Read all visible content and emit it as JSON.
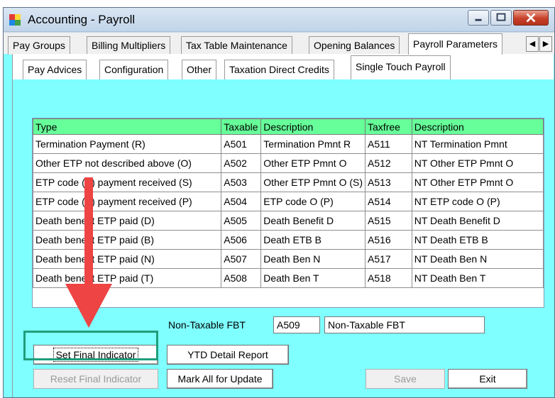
{
  "window": {
    "title": "Accounting - Payroll"
  },
  "outer_tabs": [
    {
      "label": "Pay Groups"
    },
    {
      "label": "Billing Multipliers"
    },
    {
      "label": "Tax Table Maintenance"
    },
    {
      "label": "Opening Balances"
    },
    {
      "label": "Payroll Parameters",
      "active": true
    }
  ],
  "inner_tabs": [
    {
      "label": "Pay Advices"
    },
    {
      "label": "Configuration"
    },
    {
      "label": "Other"
    },
    {
      "label": "Taxation Direct Credits"
    },
    {
      "label": "Single Touch Payroll",
      "active": true
    }
  ],
  "grid": {
    "columns": [
      "Type",
      "Taxable",
      "Description",
      "Taxfree",
      "Description"
    ],
    "rows": [
      [
        "Termination Payment  (R)",
        "A501",
        "Termination Pmnt R",
        "A511",
        "NT Termination Pmnt"
      ],
      [
        "Other ETP not described above (O)",
        "A502",
        "Other ETP Pmnt O",
        "A512",
        "NT Other ETP Pmnt O"
      ],
      [
        "ETP code (S) payment received (S)",
        "A503",
        "Other ETP Pmnt O (S)",
        "A513",
        "NT Other ETP Pmnt O"
      ],
      [
        "ETP code (P) payment received  (P)",
        "A504",
        "ETP code O (P)",
        "A514",
        "NT ETP code O (P)"
      ],
      [
        "Death benefit ETP paid  (D)",
        "A505",
        "Death Benefit D",
        "A515",
        "NT Death Benefit D"
      ],
      [
        "Death benefit ETP paid  (B)",
        "A506",
        "Death ETB B",
        "A516",
        "NT Death ETB B"
      ],
      [
        "Death benefit ETP paid  (N)",
        "A507",
        "Death Ben N",
        "A517",
        "NT Death Ben N"
      ],
      [
        "Death benefit ETP paid  (T)",
        "A508",
        "Death Ben T",
        "A518",
        "NT Death Ben T"
      ]
    ]
  },
  "fbt": {
    "label": "Non-Taxable FBT",
    "code": "A509",
    "description": "Non-Taxable FBT"
  },
  "buttons": {
    "set_final": "Set Final Indicator",
    "reset_final": "Reset Final Indicator",
    "ytd_report": "YTD Detail Report",
    "mark_all": "Mark All for Update",
    "save": "Save",
    "exit": "Exit"
  },
  "colors": {
    "client_bg": "#7fffff",
    "grid_header": "#66ff99",
    "arrow": "#ee4444",
    "highlight": "#1f9e7c"
  }
}
